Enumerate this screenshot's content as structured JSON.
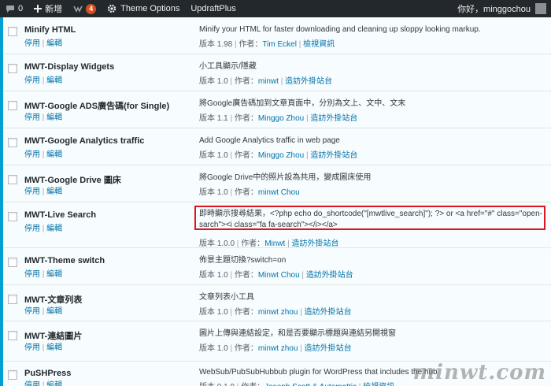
{
  "adminbar": {
    "comments_count": "0",
    "new_label": "新增",
    "updates_count": "4",
    "theme_options": "Theme Options",
    "updraftplus": "UpdraftPlus",
    "greeting": "你好，minggochou"
  },
  "plugins": [
    {
      "name": "Minify HTML",
      "deactivate": "停用",
      "edit": "編輯",
      "description": "Minify your HTML for faster downloading and cleaning up sloppy looking markup.",
      "version": "版本 1.98",
      "author_label": "作者：",
      "author": "Tim Eckel",
      "link": "檢視資訊"
    },
    {
      "name": "MWT-Display Widgets",
      "deactivate": "停用",
      "edit": "編輯",
      "description": "小工具顯示/隱藏",
      "version": "版本 1.0",
      "author_label": "作者：",
      "author": "minwt",
      "link": "造訪外掛站台"
    },
    {
      "name": "MWT-Google ADS廣告碼(for Single)",
      "deactivate": "停用",
      "edit": "編輯",
      "description": "將Google廣告碼加到文章頁面中，分別為文上、文中、文末",
      "version": "版本 1.1",
      "author_label": "作者：",
      "author": "Minggo Zhou",
      "link": "造訪外掛站台"
    },
    {
      "name": "MWT-Google Analytics traffic",
      "deactivate": "停用",
      "edit": "編輯",
      "description": "Add Google Analytics traffic in web page",
      "version": "版本 1.0",
      "author_label": "作者：",
      "author": "Minggo Zhou",
      "link": "造訪外掛站台"
    },
    {
      "name": "MWT-Google Drive 圖床",
      "deactivate": "停用",
      "edit": "編輯",
      "description": "將Google Drive中的照片設為共用，變成圖床使用",
      "version": "版本 1.0",
      "author_label": "作者：",
      "author": "minwt Chou",
      "link": ""
    },
    {
      "name": "MWT-Live Search",
      "deactivate": "停用",
      "edit": "編輯",
      "description": "即時顯示搜尋結果，<?php echo do_shortcode(\"[mwtlive_search]\"); ?> or <a href=\"#\" class=\"open-sarch\"><i class=\"fa fa-search\"></i></a>",
      "version": "版本 1.0.0",
      "author_label": "作者：",
      "author": "Minwt",
      "link": "造訪外掛站台"
    },
    {
      "name": "MWT-Theme switch",
      "deactivate": "停用",
      "edit": "編輯",
      "description": "佈景主題切換?switch=on",
      "version": "版本 1.0",
      "author_label": "作者：",
      "author": "Minwt Chou",
      "link": "造訪外掛站台"
    },
    {
      "name": "MWT-文章列表",
      "deactivate": "停用",
      "edit": "編輯",
      "description": "文章列表小工具",
      "version": "版本 1.0",
      "author_label": "作者：",
      "author": "minwt zhou",
      "link": "造訪外掛站台"
    },
    {
      "name": "MWT-連結圖片",
      "deactivate": "停用",
      "edit": "編輯",
      "description": "圖片上傳與連結設定，和是否要顯示標題與連結另開視窗",
      "version": "版本 1.0",
      "author_label": "作者：",
      "author": "minwt zhou",
      "link": "造訪外掛站台"
    },
    {
      "name": "PuSHPress",
      "deactivate": "停用",
      "edit": "編輯",
      "description": "WebSub/PubSubHubbub plugin for WordPress that includes the hub",
      "version": "版本 0.1.9",
      "author_label": "作者：",
      "author": "Joseph Scott & Automattic",
      "link": "檢視資訊"
    }
  ],
  "watermark": "minwt.com"
}
